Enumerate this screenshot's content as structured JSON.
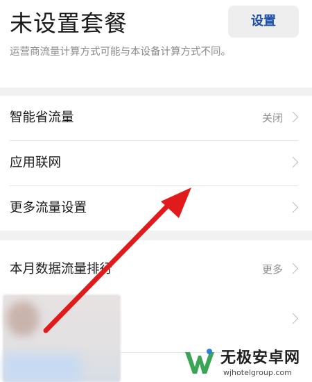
{
  "header": {
    "title": "未设置套餐",
    "set_button_label": "设置",
    "note": "运营商流量计算方式可能与本设备计算方式不同。"
  },
  "settings": {
    "rows": [
      {
        "label": "智能省流量",
        "value": "关闭"
      },
      {
        "label": "应用联网",
        "value": ""
      },
      {
        "label": "更多流量设置",
        "value": ""
      }
    ]
  },
  "ranking": {
    "title": "本月数据流量排行",
    "more_label": "更多"
  },
  "watermark": {
    "name": "无极安卓网",
    "url": "wjhotelgroup.com"
  },
  "colors": {
    "accent": "#1c4fa8",
    "arrow": "#e11b1b",
    "logo_green": "#3aa655"
  },
  "icons": {
    "chevron": "chevron-right-icon",
    "arrow": "red-annotation-arrow",
    "logo": "w-logo-icon"
  }
}
